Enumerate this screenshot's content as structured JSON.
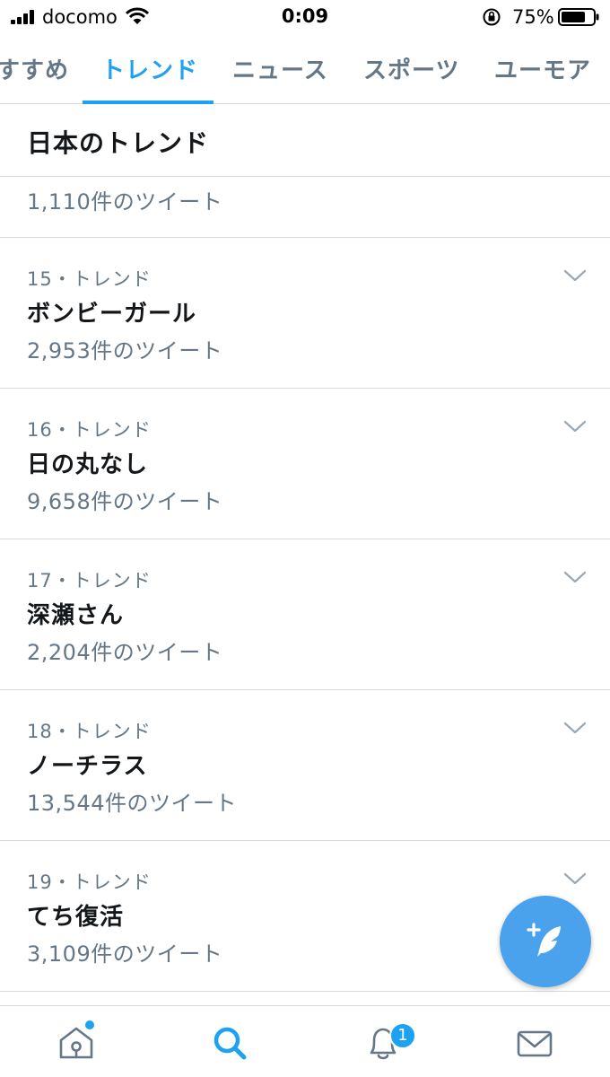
{
  "status_bar": {
    "carrier": "docomo",
    "time": "0:09",
    "battery_percent": "75%",
    "battery_level": 0.75,
    "icons": [
      "signal-icon",
      "wifi-icon",
      "rotation-lock-icon",
      "battery-icon"
    ]
  },
  "tabs": [
    {
      "label": "すすめ",
      "active": false
    },
    {
      "label": "トレンド",
      "active": true
    },
    {
      "label": "ニュース",
      "active": false
    },
    {
      "label": "スポーツ",
      "active": false
    },
    {
      "label": "ユーモア",
      "active": false
    }
  ],
  "section_title": "日本のトレンド",
  "partial_item": {
    "count": "1,110件のツイート"
  },
  "trends": [
    {
      "meta": "15・トレンド",
      "name": "ボンビーガール",
      "count": "2,953件のツイート"
    },
    {
      "meta": "16・トレンド",
      "name": "日の丸なし",
      "count": "9,658件のツイート"
    },
    {
      "meta": "17・トレンド",
      "name": "深瀬さん",
      "count": "2,204件のツイート"
    },
    {
      "meta": "18・トレンド",
      "name": "ノーチラス",
      "count": "13,544件のツイート"
    },
    {
      "meta": "19・トレンド",
      "name": "てち復活",
      "count": "3,109件のツイート"
    }
  ],
  "fab": {
    "icon": "compose-tweet-icon"
  },
  "bottom_nav": {
    "items": [
      "home-icon",
      "search-icon",
      "notifications-icon",
      "messages-icon"
    ],
    "active": "search-icon",
    "notification_badge": "1"
  },
  "colors": {
    "accent": "#1da1f2",
    "fab": "#4aa1ec",
    "secondary_text": "#657786",
    "primary_text": "#14171a",
    "divider": "#d6dadd"
  }
}
